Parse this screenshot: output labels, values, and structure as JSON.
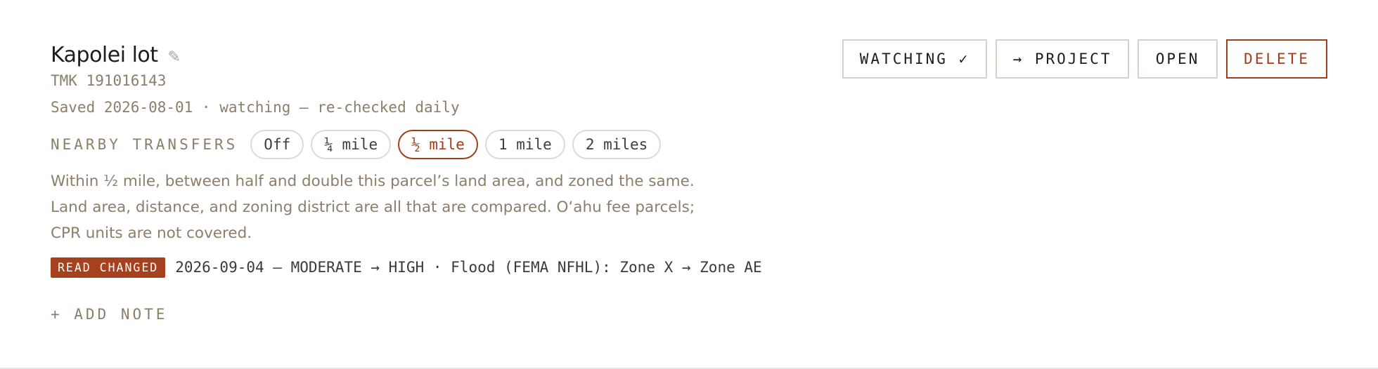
{
  "parcel": {
    "title": "Kapolei lot",
    "edit_icon": "pencil-icon",
    "tmk": "TMK 191016143",
    "saved_line": "Saved 2026-08-01 · watching — re-checked daily"
  },
  "actions": {
    "watching_label": "WATCHING ✓",
    "project_label": "→ PROJECT",
    "open_label": "OPEN",
    "delete_label": "DELETE"
  },
  "transfers": {
    "label": "NEARBY TRANSFERS",
    "options": [
      "Off",
      "¼ mile",
      "½ mile",
      "1 mile",
      "2 miles"
    ],
    "selected": "½ mile",
    "description": "Within ½ mile, between half and double this parcel’s land area, and zoned the same. Land area, distance, and zoning district are all that are compared. Oʻahu fee parcels; CPR units are not covered."
  },
  "change": {
    "badge": "READ CHANGED",
    "text": "2026-09-04 — MODERATE → HIGH · Flood (FEMA NFHL): Zone X → Zone AE"
  },
  "note": {
    "add_label": "+ ADD NOTE"
  },
  "colors": {
    "accent": "#a13e1e",
    "muted_text": "#8c7e69",
    "border": "#dedbd5"
  }
}
